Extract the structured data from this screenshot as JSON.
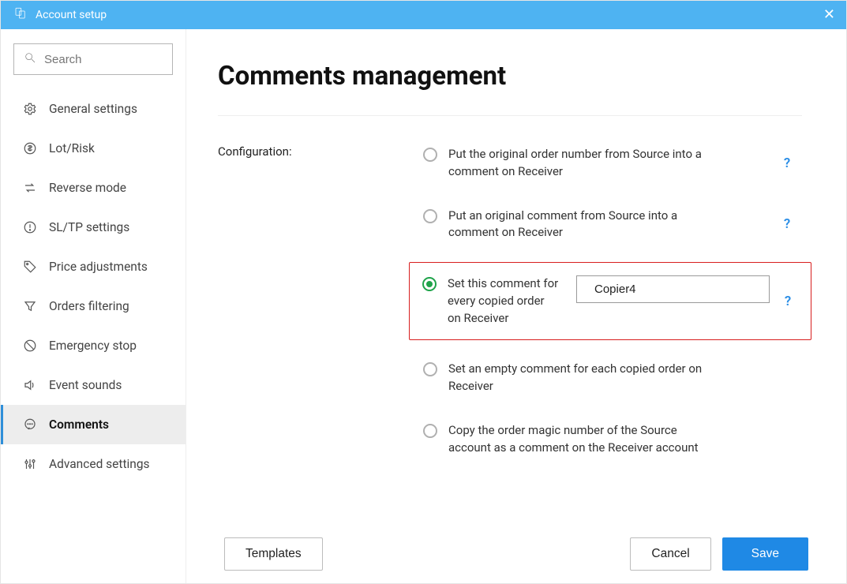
{
  "titlebar": {
    "title": "Account setup"
  },
  "search": {
    "placeholder": "Search"
  },
  "sidebar": {
    "items": [
      {
        "label": "General settings"
      },
      {
        "label": "Lot/Risk"
      },
      {
        "label": "Reverse mode"
      },
      {
        "label": "SL/TP settings"
      },
      {
        "label": "Price adjustments"
      },
      {
        "label": "Orders filtering"
      },
      {
        "label": "Emergency stop"
      },
      {
        "label": "Event sounds"
      },
      {
        "label": "Comments"
      },
      {
        "label": "Advanced settings"
      }
    ]
  },
  "page": {
    "title": "Comments management",
    "config_label": "Configuration:"
  },
  "config": {
    "selected_index": 2,
    "options": [
      {
        "label": "Put the original order number from Source into a comment on Receiver"
      },
      {
        "label": "Put an original comment from Source into a comment on Receiver"
      },
      {
        "label": "Set this comment for every copied order on Receiver",
        "input_value": "Copier4"
      },
      {
        "label": "Set an empty comment for each copied order on Receiver"
      },
      {
        "label": "Copy the order magic number of the Source account as a comment on the Receiver account"
      }
    ]
  },
  "footer": {
    "templates": "Templates",
    "cancel": "Cancel",
    "save": "Save"
  },
  "help_glyph": "?"
}
